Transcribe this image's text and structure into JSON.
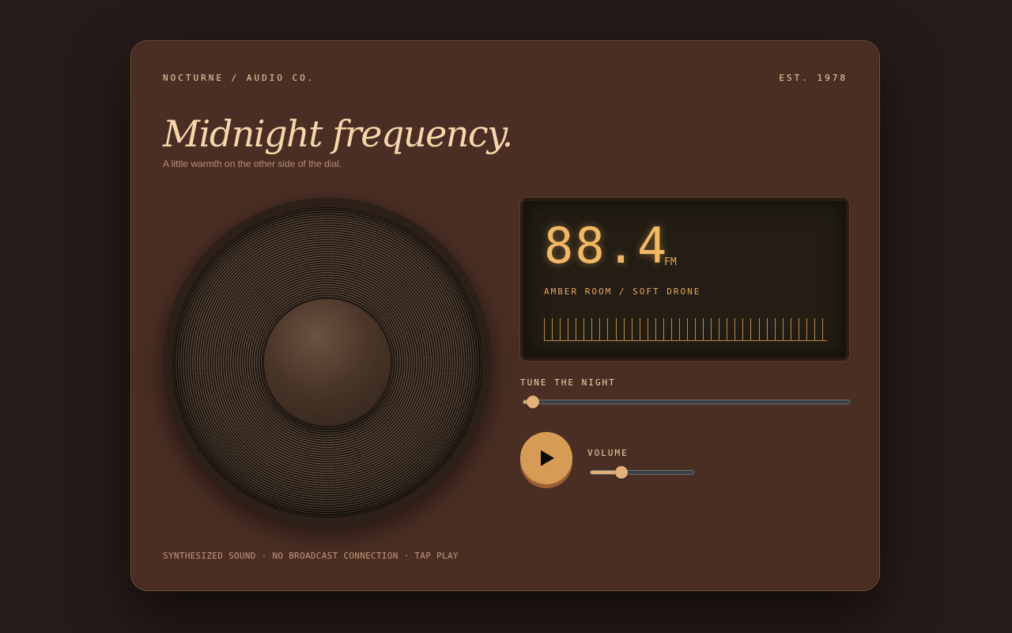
{
  "header": {
    "brand": "NOCTURNE / AUDIO CO.",
    "est": "EST. 1978"
  },
  "hero": {
    "title": "Midnight frequency.",
    "subtitle": "A little warmth on the other side of the dial."
  },
  "display": {
    "frequency": "88.4",
    "band": "FM",
    "station": "AMBER ROOM / SOFT DRONE"
  },
  "tuner": {
    "label": "TUNE THE NIGHT",
    "position_fraction": 0.03
  },
  "player": {
    "play_icon": "play-icon",
    "volume_label": "VOLUME",
    "volume_fraction": 0.3
  },
  "footer": {
    "note": "SYNTHESIZED SOUND · NO BROADCAST CONNECTION · TAP PLAY"
  },
  "colors": {
    "background": "#261b18",
    "card": "#4a2e24",
    "accent": "#d69b55",
    "display_text": "#f3b864"
  }
}
